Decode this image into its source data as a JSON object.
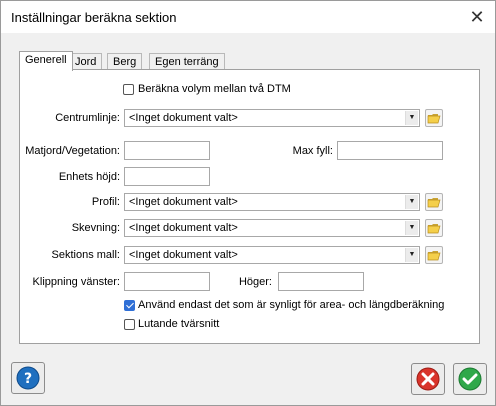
{
  "window": {
    "title": "Inställningar beräkna sektion"
  },
  "tabs": [
    "Generell",
    "Jord",
    "Berg",
    "Egen terräng"
  ],
  "panel": {
    "dtm_volume_checkbox": {
      "label": "Beräkna volym mellan två DTM",
      "checked": false
    },
    "centerline": {
      "label": "Centrumlinje:",
      "value": "<Inget dokument valt>"
    },
    "topsoil": {
      "label": "Matjord/Vegetation:",
      "value": ""
    },
    "max_fill": {
      "label": "Max fyll:",
      "value": ""
    },
    "unit_height": {
      "label": "Enhets höjd:",
      "value": ""
    },
    "profile": {
      "label": "Profil:",
      "value": "<Inget dokument valt>"
    },
    "cant": {
      "label": "Skevning:",
      "value": "<Inget dokument valt>"
    },
    "section_template": {
      "label": "Sektions mall:",
      "value": "<Inget dokument valt>"
    },
    "clip_left": {
      "label": "Klippning vänster:",
      "value": ""
    },
    "clip_right": {
      "label": "Höger:",
      "value": ""
    },
    "use_visible_checkbox": {
      "label": "Använd endast det som är synligt för area- och längdberäkning",
      "checked": true
    },
    "sloping_checkbox": {
      "label": "Lutande tvärsnitt",
      "checked": false
    }
  },
  "icons": {
    "help": "help-icon",
    "cancel": "cancel-icon",
    "ok": "ok-icon",
    "folder": "folder-icon",
    "close": "close-icon"
  },
  "colors": {
    "accent": "#2f6fd6",
    "cancel_red": "#d9342b",
    "ok_green": "#2fa84a",
    "help_blue": "#1f6fbf"
  }
}
